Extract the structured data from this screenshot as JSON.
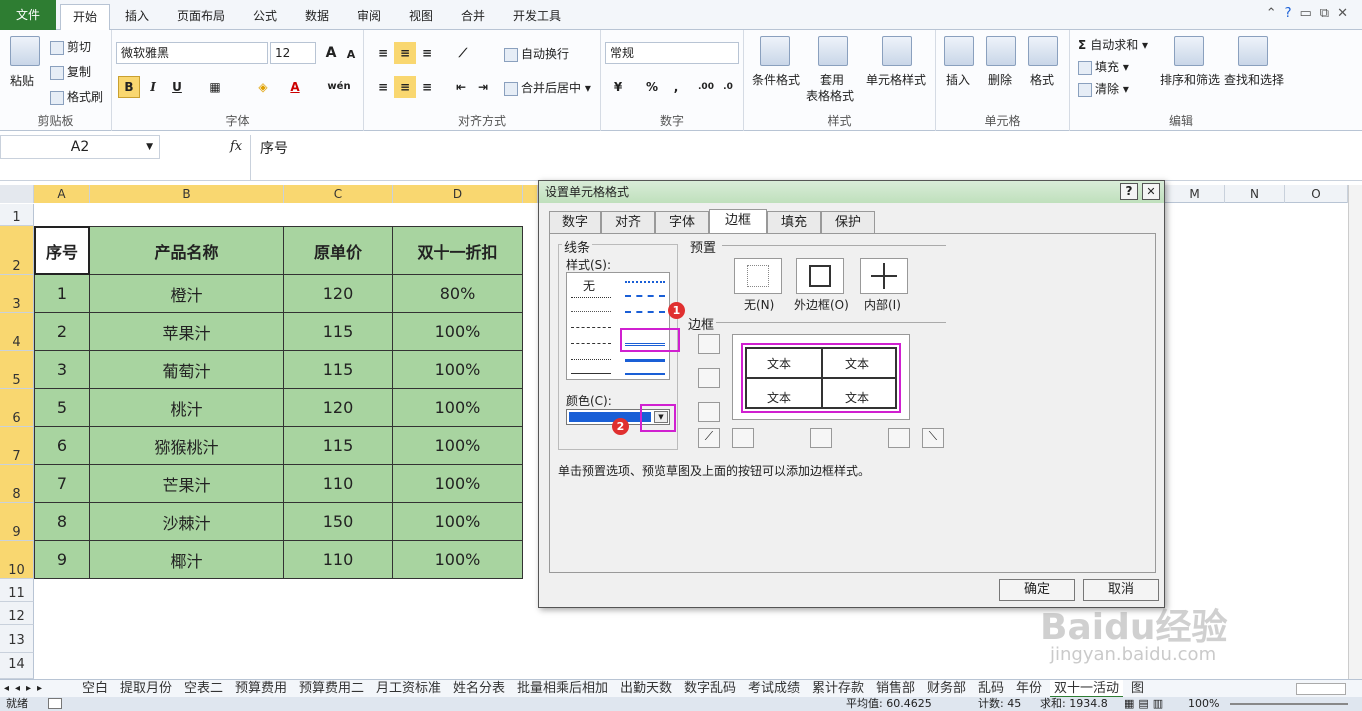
{
  "tabs": {
    "file": "文件",
    "items": [
      "开始",
      "插入",
      "页面布局",
      "公式",
      "数据",
      "审阅",
      "视图",
      "合并",
      "开发工具"
    ]
  },
  "ribbon": {
    "clipboard": {
      "paste": "粘贴",
      "cut": "剪切",
      "copy": "复制",
      "format_painter": "格式刷",
      "label": "剪贴板"
    },
    "font": {
      "name": "微软雅黑",
      "size": "12",
      "grow": "A",
      "shrink": "A",
      "bold": "B",
      "italic": "I",
      "underline": "U",
      "wen": "wén",
      "label": "字体"
    },
    "align": {
      "wrap": "自动换行",
      "merge": "合并后居中",
      "label": "对齐方式"
    },
    "number": {
      "format": "常规",
      "percent": "%",
      "comma": ",",
      "label": "数字"
    },
    "styles": {
      "cond": "条件格式",
      "table1": "套用",
      "table2": "表格格式",
      "cellstyle": "单元格样式",
      "label": "样式"
    },
    "cells": {
      "insert": "插入",
      "delete": "删除",
      "format": "格式",
      "label": "单元格"
    },
    "editing": {
      "autosum": "自动求和",
      "fill": "填充",
      "clear": "清除",
      "sort": "排序和筛选",
      "find": "查找和选择",
      "label": "编辑"
    }
  },
  "formula": {
    "namebox": "A2",
    "fx": "fx",
    "content": "序号"
  },
  "columns": [
    "A",
    "B",
    "C",
    "D",
    "M",
    "N",
    "O"
  ],
  "rows": [
    "1",
    "2",
    "3",
    "4",
    "5",
    "6",
    "7",
    "8",
    "9",
    "10",
    "11",
    "12",
    "13",
    "14"
  ],
  "table": {
    "headers": [
      "序号",
      "产品名称",
      "原单价",
      "双十一折扣"
    ],
    "rows": [
      [
        "1",
        "橙汁",
        "120",
        "80%"
      ],
      [
        "2",
        "苹果汁",
        "115",
        "100%"
      ],
      [
        "3",
        "葡萄汁",
        "115",
        "100%"
      ],
      [
        "5",
        "桃汁",
        "120",
        "100%"
      ],
      [
        "6",
        "猕猴桃汁",
        "115",
        "100%"
      ],
      [
        "7",
        "芒果汁",
        "110",
        "100%"
      ],
      [
        "8",
        "沙棘汁",
        "150",
        "100%"
      ],
      [
        "9",
        "椰汁",
        "110",
        "100%"
      ]
    ]
  },
  "dialog": {
    "title": "设置单元格格式",
    "help": "?",
    "close": "✕",
    "tabs": [
      "数字",
      "对齐",
      "字体",
      "边框",
      "填充",
      "保护"
    ],
    "line_group": "线条",
    "style_label": "样式(S):",
    "style_none": "无",
    "color_label": "颜色(C):",
    "preset_group": "预置",
    "presets": [
      "无(N)",
      "外边框(O)",
      "内部(I)"
    ],
    "border_group": "边框",
    "preview_text": [
      "文本",
      "文本",
      "文本",
      "文本"
    ],
    "hint": "单击预置选项、预览草图及上面的按钮可以添加边框样式。",
    "ok": "确定",
    "cancel": "取消",
    "markers": [
      "1",
      "2"
    ],
    "selected_color": "#1a5fd6"
  },
  "sheet_tabs": [
    "空白",
    "提取月份",
    "空表二",
    "预算费用",
    "预算费用二",
    "月工资标准",
    "姓名分表",
    "批量相乘后相加",
    "出勤天数",
    "数字乱码",
    "考试成绩",
    "累计存款",
    "销售部",
    "财务部",
    "乱码",
    "年份",
    "双十一活动",
    "图"
  ],
  "status": {
    "ready": "就绪",
    "average": "平均值: 60.4625",
    "count": "计数: 45",
    "sum": "求和: 1934.8",
    "zoom": "100%"
  },
  "watermark": {
    "brand": "Baidu经验",
    "url": "jingyan.baidu.com"
  },
  "colors": {
    "file_tab": "#2e7d32",
    "cell_fill": "#a8d4a0",
    "highlight": "#d020d0",
    "marker": "#e03030",
    "selected_header": "#f9d770"
  }
}
